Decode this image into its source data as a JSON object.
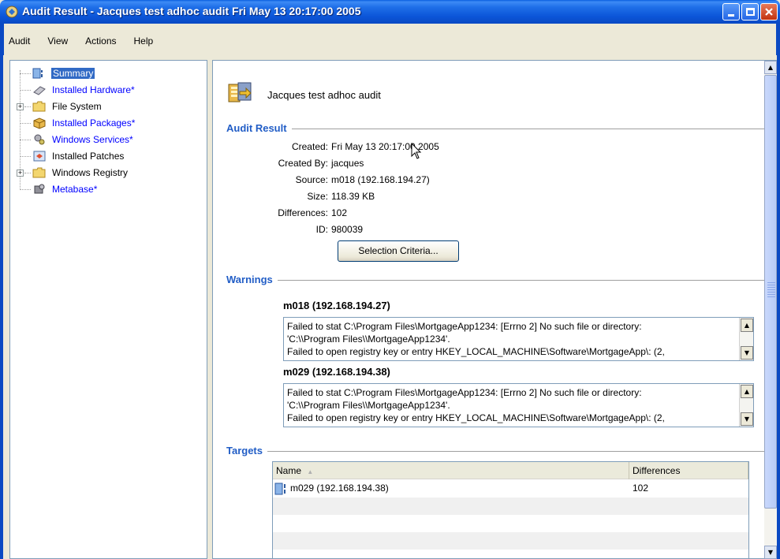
{
  "window": {
    "title": "Audit Result - Jacques test adhoc audit Fri May 13 20:17:00 2005"
  },
  "menu": [
    "Audit",
    "View",
    "Actions",
    "Help"
  ],
  "tree": [
    {
      "label": "Summary",
      "icon": "summary-icon",
      "style": "selected",
      "expander": false
    },
    {
      "label": "Installed Hardware*",
      "icon": "hardware-icon",
      "style": "blue",
      "expander": false
    },
    {
      "label": "File System",
      "icon": "folder-icon",
      "style": "normal",
      "expander": true
    },
    {
      "label": "Installed Packages*",
      "icon": "package-icon",
      "style": "blue",
      "expander": false
    },
    {
      "label": "Windows Services*",
      "icon": "services-icon",
      "style": "blue",
      "expander": false
    },
    {
      "label": "Installed Patches",
      "icon": "patch-icon",
      "style": "normal",
      "expander": false
    },
    {
      "label": "Windows Registry",
      "icon": "folder-icon",
      "style": "normal",
      "expander": true
    },
    {
      "label": "Metabase*",
      "icon": "metabase-icon",
      "style": "blue",
      "expander": false
    }
  ],
  "summary": {
    "title": "Jacques test adhoc audit"
  },
  "audit_result": {
    "header": "Audit Result",
    "fields": [
      {
        "label": "Created:",
        "value": "Fri May 13 20:17:00 2005"
      },
      {
        "label": "Created By:",
        "value": "jacques"
      },
      {
        "label": "Source:",
        "value": "m018 (192.168.194.27)"
      },
      {
        "label": "Size:",
        "value": "118.39 KB"
      },
      {
        "label": "Differences:",
        "value": "102"
      },
      {
        "label": "ID:",
        "value": "980039"
      }
    ],
    "button": "Selection Criteria..."
  },
  "warnings": {
    "header": "Warnings",
    "hosts": [
      {
        "name": "m018 (192.168.194.27)",
        "lines": [
          "Failed to stat C:\\Program Files\\MortgageApp1234: [Errno 2] No such file or directory:",
          "'C:\\\\Program Files\\\\MortgageApp1234'.",
          "Failed to open registry key or entry HKEY_LOCAL_MACHINE\\Software\\MortgageApp\\: (2,"
        ]
      },
      {
        "name": "m029 (192.168.194.38)",
        "lines": [
          "Failed to stat C:\\Program Files\\MortgageApp1234: [Errno 2] No such file or directory:",
          "'C:\\\\Program Files\\\\MortgageApp1234'.",
          "Failed to open registry key or entry HKEY_LOCAL_MACHINE\\Software\\MortgageApp\\: (2,"
        ]
      }
    ]
  },
  "targets": {
    "header": "Targets",
    "columns": [
      "Name",
      "Differences"
    ],
    "rows": [
      {
        "name": "m029 (192.168.194.38)",
        "differences": "102"
      }
    ]
  }
}
